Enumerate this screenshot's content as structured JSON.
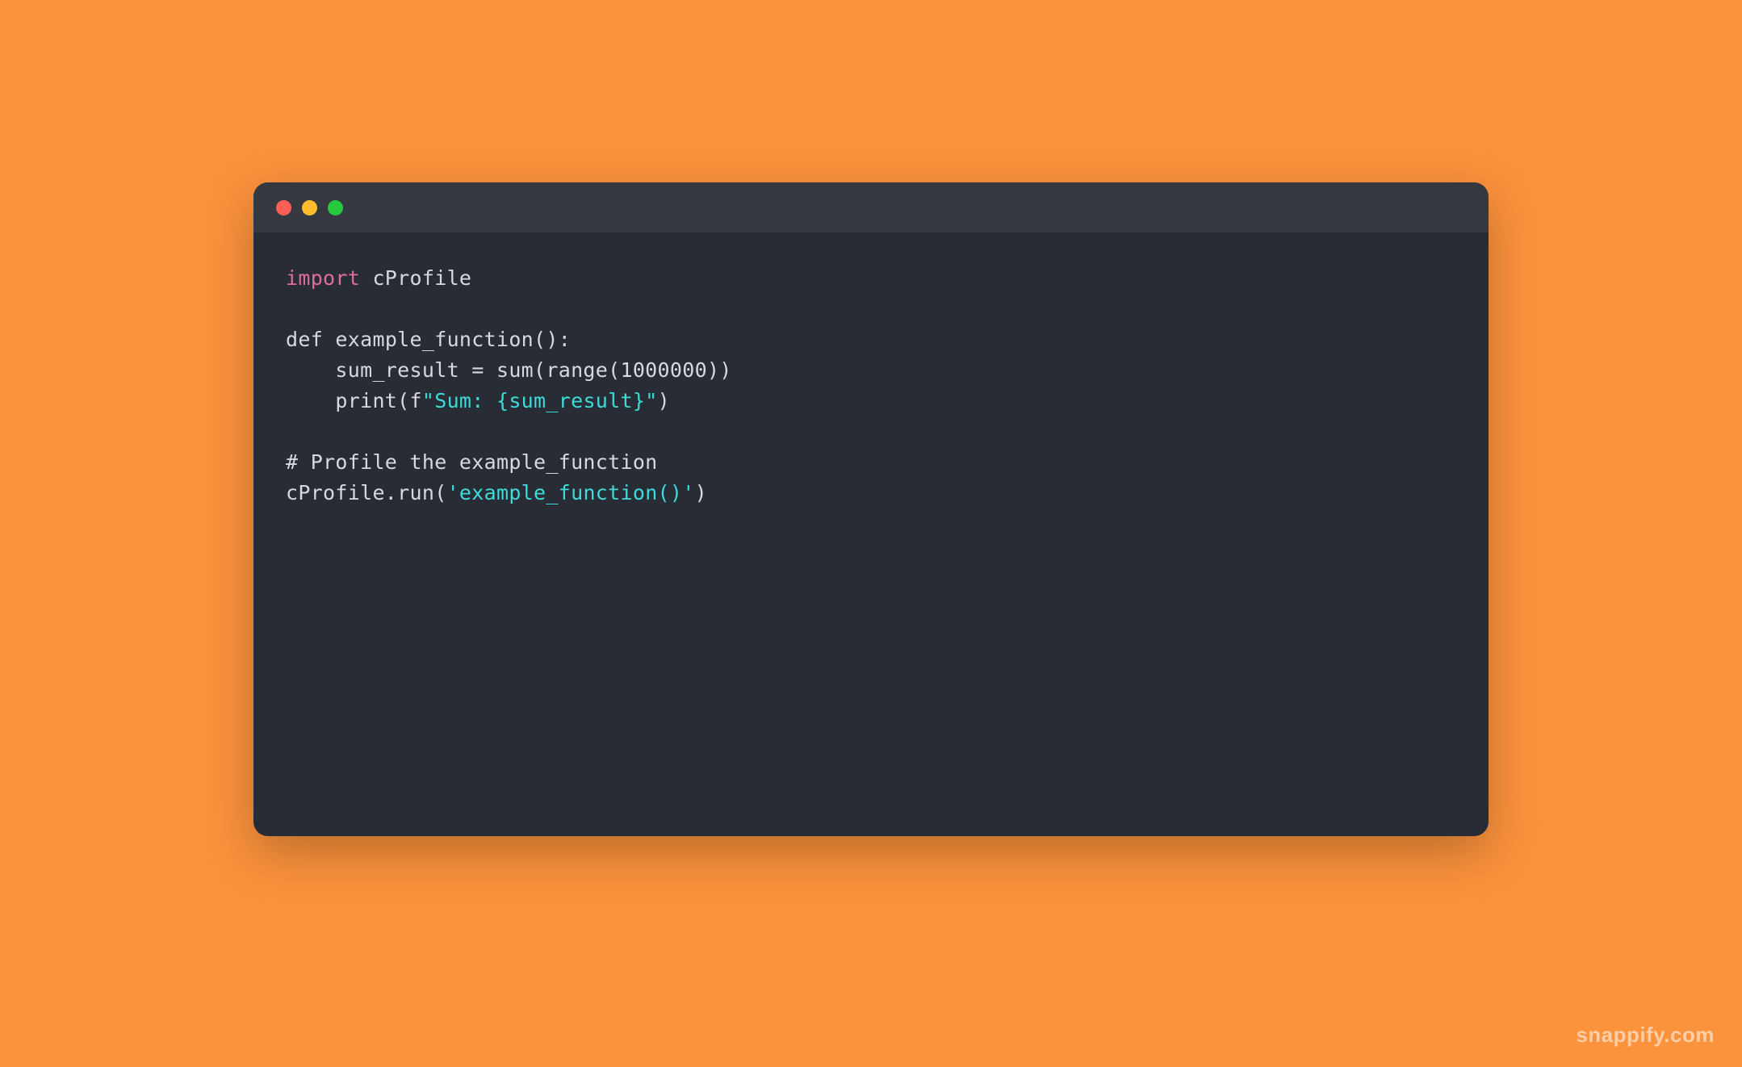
{
  "code": {
    "lines": [
      {
        "segments": [
          {
            "text": "import",
            "class": "kw-import"
          },
          {
            "text": " cProfile",
            "class": ""
          }
        ]
      },
      {
        "segments": [
          {
            "text": "",
            "class": ""
          }
        ]
      },
      {
        "segments": [
          {
            "text": "def",
            "class": "kw-def"
          },
          {
            "text": " example_function():",
            "class": ""
          }
        ]
      },
      {
        "segments": [
          {
            "text": "    sum_result = sum(range(1000000))",
            "class": ""
          }
        ]
      },
      {
        "segments": [
          {
            "text": "    print(f",
            "class": ""
          },
          {
            "text": "\"Sum: ",
            "class": "str"
          },
          {
            "text": "{sum_result}",
            "class": "fstr-brace"
          },
          {
            "text": "\"",
            "class": "str"
          },
          {
            "text": ")",
            "class": ""
          }
        ]
      },
      {
        "segments": [
          {
            "text": "",
            "class": ""
          }
        ]
      },
      {
        "segments": [
          {
            "text": "# Profile the example_function",
            "class": ""
          }
        ]
      },
      {
        "segments": [
          {
            "text": "cProfile.run(",
            "class": ""
          },
          {
            "text": "'example_function()'",
            "class": "str"
          },
          {
            "text": ")",
            "class": ""
          }
        ]
      }
    ]
  },
  "watermark": "snappify.com"
}
